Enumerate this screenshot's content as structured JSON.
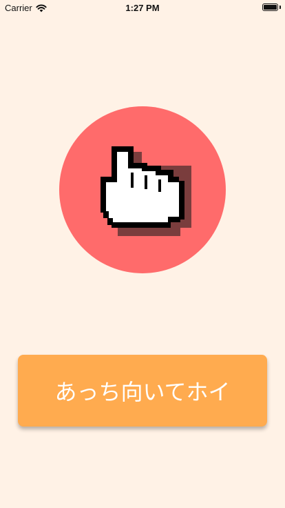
{
  "status_bar": {
    "carrier": "Carrier",
    "time": "1:27 PM",
    "wifi_icon": "wifi-icon",
    "battery_icon": "battery-icon"
  },
  "hand": {
    "icon": "pointing-hand-cursor-icon",
    "circle_color": "#ff6b6b"
  },
  "action_button": {
    "label": "あっち向いてホイ",
    "color": "#ffab4f"
  },
  "background_color": "#fff2e6"
}
